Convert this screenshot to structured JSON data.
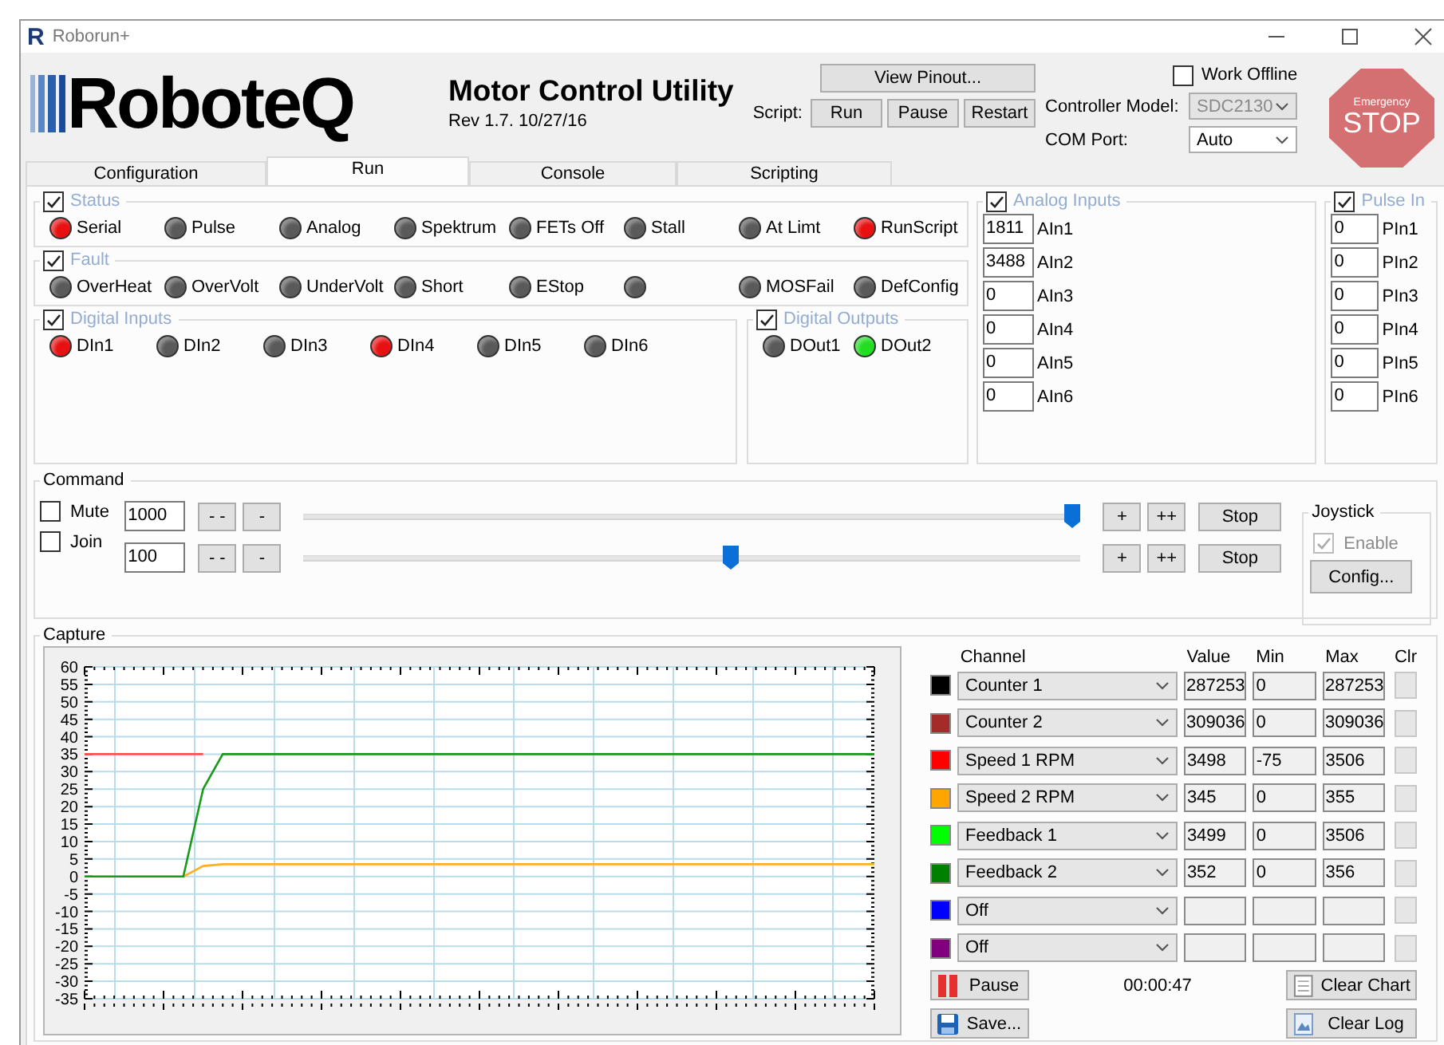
{
  "window": {
    "icon_letter": "R",
    "title": "Roborun+"
  },
  "header": {
    "logo": "RoboteQ",
    "app_title": "Motor Control Utility",
    "revision": "Rev 1.7. 10/27/16",
    "view_pinout": "View Pinout...",
    "script_label": "Script:",
    "script_buttons": [
      "Run",
      "Pause",
      "Restart"
    ],
    "work_offline": {
      "label": "Work Offline",
      "checked": false
    },
    "controller_model": {
      "label": "Controller Model:",
      "value": "SDC2130",
      "disabled": true
    },
    "com_port": {
      "label": "COM Port:",
      "value": "Auto",
      "disabled": false
    },
    "estop": {
      "caption": "Emergency",
      "label": "STOP"
    }
  },
  "tabs": [
    {
      "label": "Configuration",
      "selected": false
    },
    {
      "label": "Run",
      "selected": true
    },
    {
      "label": "Console",
      "selected": false
    },
    {
      "label": "Scripting",
      "selected": false
    }
  ],
  "status": {
    "title": "Status",
    "checked": true,
    "leds": [
      {
        "label": "Serial",
        "color": "#e81010"
      },
      {
        "label": "Pulse",
        "color": "#5a5a5a"
      },
      {
        "label": "Analog",
        "color": "#5a5a5a"
      },
      {
        "label": "Spektrum",
        "color": "#5a5a5a"
      },
      {
        "label": "FETs Off",
        "color": "#5a5a5a"
      },
      {
        "label": "Stall",
        "color": "#5a5a5a"
      },
      {
        "label": "At Limt",
        "color": "#5a5a5a"
      },
      {
        "label": "RunScript",
        "color": "#e81010"
      }
    ]
  },
  "fault": {
    "title": "Fault",
    "checked": true,
    "leds": [
      {
        "label": "OverHeat",
        "color": "#5a5a5a"
      },
      {
        "label": "OverVolt",
        "color": "#5a5a5a"
      },
      {
        "label": "UnderVolt",
        "color": "#5a5a5a"
      },
      {
        "label": "Short",
        "color": "#5a5a5a"
      },
      {
        "label": "EStop",
        "color": "#5a5a5a"
      },
      {
        "color": "#5a5a5a"
      },
      {
        "label": "MOSFail",
        "color": "#5a5a5a"
      },
      {
        "label": "DefConfig",
        "color": "#5a5a5a"
      }
    ]
  },
  "digital_inputs": {
    "title": "Digital Inputs",
    "checked": true,
    "leds": [
      {
        "label": "DIn1",
        "color": "#e81010"
      },
      {
        "label": "DIn2",
        "color": "#5a5a5a"
      },
      {
        "label": "DIn3",
        "color": "#5a5a5a"
      },
      {
        "label": "DIn4",
        "color": "#e81010"
      },
      {
        "label": "DIn5",
        "color": "#5a5a5a"
      },
      {
        "label": "DIn6",
        "color": "#5a5a5a"
      }
    ]
  },
  "digital_outputs": {
    "title": "Digital Outputs",
    "checked": true,
    "leds": [
      {
        "label": "DOut1",
        "color": "#5a5a5a"
      },
      {
        "label": "DOut2",
        "color": "#22dd22"
      }
    ]
  },
  "analog_inputs": {
    "title": "Analog Inputs",
    "checked": true,
    "items": [
      {
        "value": "1811",
        "label": "AIn1"
      },
      {
        "value": "3488",
        "label": "AIn2"
      },
      {
        "value": "0",
        "label": "AIn3"
      },
      {
        "value": "0",
        "label": "AIn4"
      },
      {
        "value": "0",
        "label": "AIn5"
      },
      {
        "value": "0",
        "label": "AIn6"
      }
    ]
  },
  "pulse_inputs": {
    "title": "Pulse In",
    "checked": true,
    "items": [
      {
        "value": "0",
        "label": "PIn1"
      },
      {
        "value": "0",
        "label": "PIn2"
      },
      {
        "value": "0",
        "label": "PIn3"
      },
      {
        "value": "0",
        "label": "PIn4"
      },
      {
        "value": "0",
        "label": "PIn5"
      },
      {
        "value": "0",
        "label": "PIn6"
      }
    ]
  },
  "command": {
    "title": "Command",
    "options": [
      {
        "label": "Mute",
        "checked": false
      },
      {
        "label": "Join",
        "checked": false
      }
    ],
    "rows": [
      {
        "value": "1000",
        "minus_buttons": [
          "- -",
          "-"
        ],
        "level": 0.99,
        "plus_buttons": [
          "+",
          "++"
        ],
        "stop": "Stop"
      },
      {
        "value": "100",
        "minus_buttons": [
          "- -",
          "-"
        ],
        "level": 0.55,
        "plus_buttons": [
          "+",
          "++"
        ],
        "stop": "Stop"
      }
    ],
    "joystick": {
      "title": "Joystick",
      "enable": {
        "label": "Enable",
        "checked": true,
        "disabled": true
      },
      "config": "Config..."
    }
  },
  "capture": {
    "title": "Capture",
    "chart_data": {
      "type": "line",
      "grid": true,
      "ylim": [
        -35,
        60
      ],
      "yticks": [
        60,
        55,
        50,
        45,
        40,
        35,
        30,
        25,
        20,
        15,
        10,
        5,
        0,
        -5,
        -10,
        -15,
        -20,
        -25,
        -30,
        -35
      ],
      "series": [
        {
          "color": "#ff5050",
          "values": [
            35,
            35,
            35,
            35,
            35,
            35,
            35,
            null,
            null,
            null,
            null,
            null,
            null,
            null,
            null,
            null,
            null,
            null,
            null,
            null,
            null,
            null,
            null,
            null,
            null,
            null,
            null,
            null,
            null,
            null,
            null,
            null,
            null,
            null,
            null,
            null,
            null,
            null,
            null,
            null,
            null
          ]
        },
        {
          "color": "#ffb020",
          "values": [
            null,
            null,
            null,
            null,
            null,
            0,
            3,
            3.5,
            3.5,
            3.5,
            3.5,
            3.5,
            3.5,
            3.5,
            3.5,
            3.5,
            3.5,
            3.5,
            3.5,
            3.5,
            3.5,
            3.5,
            3.5,
            3.5,
            3.5,
            3.5,
            3.5,
            3.5,
            3.5,
            3.5,
            3.5,
            3.5,
            3.5,
            3.5,
            3.5,
            3.5,
            3.5,
            3.5,
            3.5,
            3.5,
            3.5
          ]
        },
        {
          "color": "#1a9a1a",
          "values": [
            0,
            0,
            0,
            0,
            0,
            0,
            25,
            35,
            35,
            35,
            35,
            35,
            35,
            35,
            35,
            35,
            35,
            35,
            35,
            35,
            35,
            35,
            35,
            35,
            35,
            35,
            35,
            35,
            35,
            35,
            35,
            35,
            35,
            35,
            35,
            35,
            35,
            35,
            35,
            35,
            35
          ]
        }
      ]
    },
    "columns": [
      "Channel",
      "Value",
      "Min",
      "Max",
      "Clr"
    ],
    "rows": [
      {
        "color": "#000000",
        "channel": "Counter 1",
        "value": "287253",
        "min": "0",
        "max": "287253"
      },
      {
        "color": "#a52a2a",
        "channel": "Counter 2",
        "value": "309036",
        "min": "0",
        "max": "309036"
      },
      {
        "color": "#ff0000",
        "channel": "Speed 1 RPM",
        "value": "3498",
        "min": "-75",
        "max": "3506"
      },
      {
        "color": "#ffa500",
        "channel": "Speed 2 RPM",
        "value": "345",
        "min": "0",
        "max": "355"
      },
      {
        "color": "#00ff00",
        "channel": "Feedback 1",
        "value": "3499",
        "min": "0",
        "max": "3506"
      },
      {
        "color": "#008000",
        "channel": "Feedback 2",
        "value": "352",
        "min": "0",
        "max": "356"
      },
      {
        "color": "#0000ff",
        "channel": "Off"
      },
      {
        "color": "#800080",
        "channel": "Off"
      }
    ],
    "pause": "Pause",
    "save": "Save...",
    "elapsed": "00:00:47",
    "clear_chart": "Clear Chart",
    "clear_log": "Clear Log"
  }
}
